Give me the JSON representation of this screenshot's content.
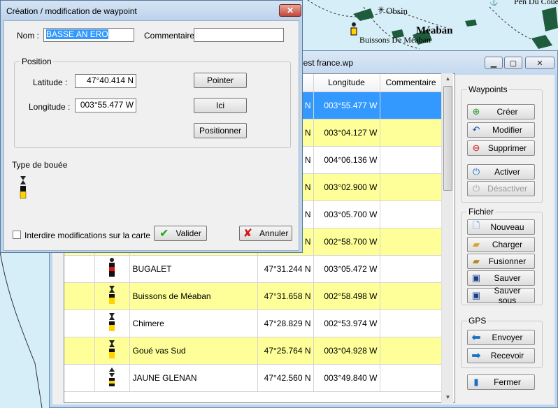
{
  "chart": {
    "labels": [
      "Pen Du Coue",
      "Obsin",
      "Méaban",
      "Buissons De Méaban"
    ],
    "colors": {
      "land": "#1f5c3d",
      "water": "#d6eef7",
      "buoy": "#222222"
    }
  },
  "list_window": {
    "title": "uest france.wp",
    "columns": [
      "",
      "",
      "",
      "",
      "Longitude",
      "Commentaire"
    ],
    "rows": [
      {
        "name": "",
        "lat": "N",
        "lon": "003°55.477 W",
        "comment": "",
        "style": "selected",
        "icon": "none"
      },
      {
        "name": "",
        "lat": "N",
        "lon": "003°04.127 W",
        "comment": "",
        "style": "yellow",
        "icon": "none"
      },
      {
        "name": "",
        "lat": "N",
        "lon": "004°06.136 W",
        "comment": "",
        "style": "white",
        "icon": "none"
      },
      {
        "name": "",
        "lat": "N",
        "lon": "003°02.900 W",
        "comment": "",
        "style": "yellow",
        "icon": "none"
      },
      {
        "name": "",
        "lat": "N",
        "lon": "003°05.700 W",
        "comment": "",
        "style": "white",
        "icon": "none"
      },
      {
        "name": "",
        "lat": "N",
        "lon": "002°58.700 W",
        "comment": "",
        "style": "yellow",
        "icon": "none"
      },
      {
        "name": "BUGALET",
        "lat": "47°31.244 N",
        "lon": "003°05.472 W",
        "comment": "",
        "style": "white",
        "icon": "red"
      },
      {
        "name": "Buissons de Méaban",
        "lat": "47°31.658 N",
        "lon": "002°58.498 W",
        "comment": "",
        "style": "yellow",
        "icon": "yellow"
      },
      {
        "name": "Chimere",
        "lat": "47°28.829 N",
        "lon": "002°53.974 W",
        "comment": "",
        "style": "white",
        "icon": "yellow"
      },
      {
        "name": "Goué vas Sud",
        "lat": "47°25.764 N",
        "lon": "003°04.928 W",
        "comment": "",
        "style": "yellow",
        "icon": "yellow"
      },
      {
        "name": "JAUNE GLENAN",
        "lat": "47°42.560 N",
        "lon": "003°49.840 W",
        "comment": "",
        "style": "white",
        "icon": "black"
      }
    ],
    "waypoints_group": {
      "label": "Waypoints",
      "create": "Créer",
      "modify": "Modifier",
      "delete": "Supprimer",
      "activate": "Activer",
      "deactivate": "Désactiver"
    },
    "file_group": {
      "label": "Fichier",
      "new": "Nouveau",
      "load": "Charger",
      "merge": "Fusionner",
      "save": "Sauver",
      "save_as": "Sauver sous"
    },
    "gps_group": {
      "label": "GPS",
      "send": "Envoyer",
      "receive": "Recevoir"
    },
    "close": "Fermer"
  },
  "dialog": {
    "title": "Création / modification de waypoint",
    "name_label": "Nom :",
    "name_value": "BASSE AN ERO",
    "comment_label": "Commentaire :",
    "comment_value": "",
    "position_legend": "Position",
    "latitude_label": "Latitude :",
    "latitude_value": "47°40.414 N",
    "longitude_label": "Longitude :",
    "longitude_value": "003°55.477 W",
    "btn_point": "Pointer",
    "btn_here": "Ici",
    "btn_position": "Positionner",
    "buoy_type_label": "Type de bouée",
    "lock_label": "Interdire modifications sur la carte",
    "validate": "Valider",
    "cancel": "Annuler"
  }
}
